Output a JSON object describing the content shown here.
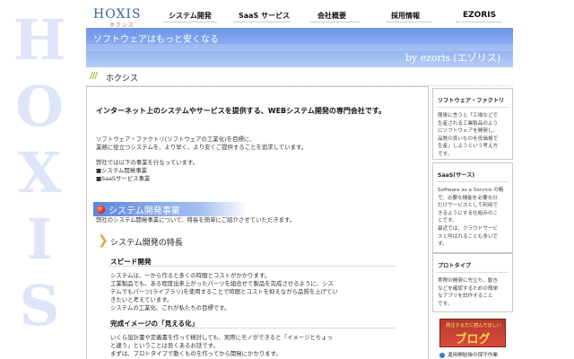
{
  "watermark": {
    "letters": [
      "H",
      "O",
      "X",
      "I",
      "S"
    ]
  },
  "nav": {
    "logo": "HOXIS",
    "logo_sub": "ホクシス",
    "items": [
      "システム開発",
      "SaaS サービス",
      "会社概要",
      "採用情報",
      "EZORIS"
    ]
  },
  "banner": {
    "tagline": "ソフトウェアはもっと安くなる",
    "by": "by ezoris (エゾリス)"
  },
  "breadcrumb": {
    "slashes": "///",
    "text": "ホクシス"
  },
  "main": {
    "lead": "インターネット上のシステムやサービスを提供する、WEBシステム開発の専門会社です。",
    "intro_lines": [
      "ソフトウェア・ファクトリ(ソフトウェアの工業化)を目標に、",
      "業務に役立つシステムを、より早く、より安くご提供することを追求しています。"
    ],
    "business_lines": [
      "弊社では以下の事業を行なっています。",
      "■システム開発事業",
      "■SaaSサービス事業"
    ],
    "section_title": "システム開発事業",
    "section_desc": "弊社のシステム開発事業について、特長を簡単にご紹介させていただきます。",
    "feature_title": "システム開発の特長",
    "h_speed": "スピード開発",
    "speed_lines": [
      "システムは、一から作ると多くの時間とコストがかかります。",
      "工業製品でも、ある程度出来上がったパーツを組合せて製品を完成させるように、シス",
      "テムでもパーツ(ライブラリ)を使用することで時間とコストを抑えながら品質を上げてい",
      "きたいと考えています。",
      "システムの工業化、これが私たちの目標です。"
    ],
    "h_image": "完成イメージの「見える化」",
    "image_lines": [
      "いくら設計書や定義書を作って検討しても、実際にモノができると「イメージとちょっ",
      "と違う」ということは良くあるお話です。",
      "まずは、プロトタイプで動くものを作ってから開発にかかります。"
    ]
  },
  "sidebar": {
    "box1": {
      "title": "ソフトウェア・ファクトリ",
      "lines": [
        "簡単に言うと「工場などで",
        "生産される工業製品のよう",
        "にソフトウェアを開発し、",
        "品質の良いものを低価格で",
        "生産」しようという考え方",
        "です。"
      ]
    },
    "box2": {
      "title": "SaaS(サース)",
      "lines": [
        "Software as a Service の略",
        "で、必要な機能を必要な分",
        "だけサービスとして利用で",
        "きるようにする仕組みのこ",
        "とです。",
        "最近では、クラウドサービ",
        "スと呼ばれることも多いで",
        "す。"
      ]
    },
    "box3": {
      "title": "プロトタイプ",
      "lines": [
        "実際の開発に先立ち、動き",
        "などを確認するための簡単",
        "なアプリを試作すること",
        "です。"
      ]
    },
    "blog_top": "発注する方に読んでほしい",
    "blog_word": "ブログ",
    "last_link": "運用開始後の保守作業"
  }
}
